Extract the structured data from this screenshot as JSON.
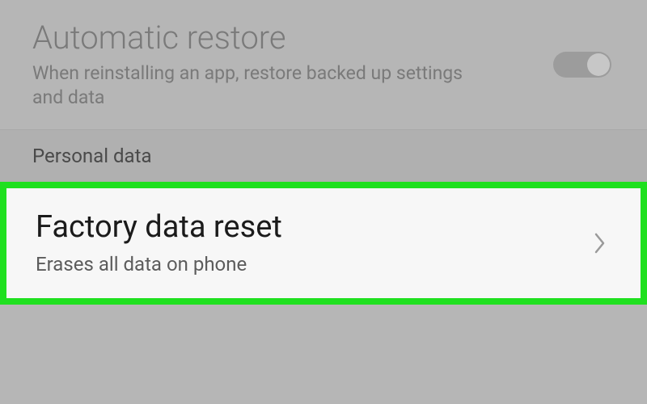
{
  "backup": {
    "automatic_restore": {
      "title": "Automatic restore",
      "subtitle": "When reinstalling an app, restore backed up settings and data",
      "toggle_on": true
    }
  },
  "sections": {
    "personal_data_header": "Personal data"
  },
  "personal_data": {
    "factory_reset": {
      "title": "Factory data reset",
      "subtitle": "Erases all data on phone"
    }
  },
  "highlight_color": "#1fe01f"
}
